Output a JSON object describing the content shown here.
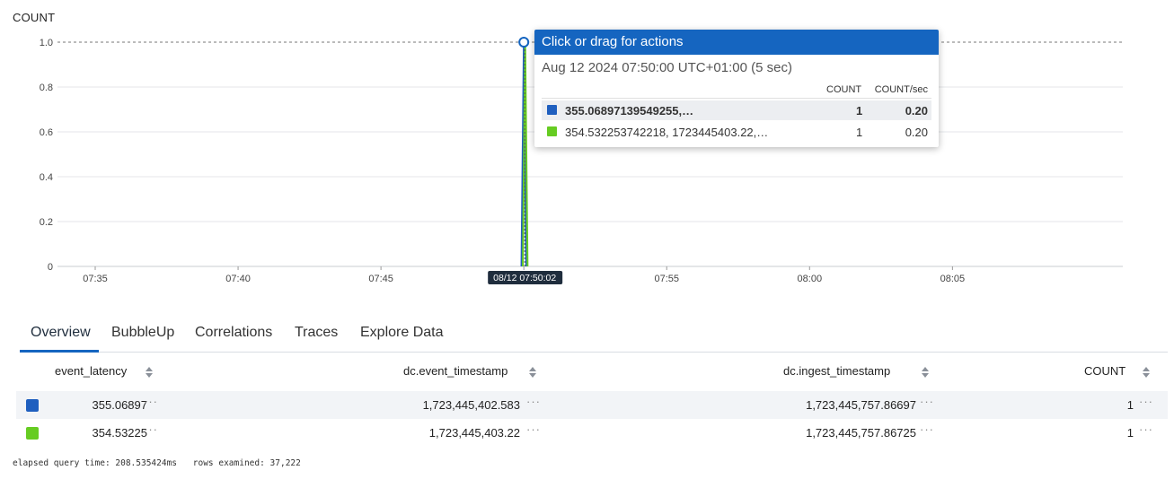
{
  "chart": {
    "title": "COUNT",
    "crosshair_label": "08/12 07:50:02"
  },
  "chart_data": {
    "type": "line",
    "ylabel": "COUNT",
    "ylim": [
      0,
      1
    ],
    "y_ticks": [
      "0",
      "0.2",
      "0.4",
      "0.6",
      "0.8",
      "1.0"
    ],
    "x_ticks": [
      "07:35",
      "07:40",
      "07:45",
      "07:50",
      "07:55",
      "08:00",
      "08:05"
    ],
    "grid": true,
    "series": [
      {
        "values": [
          {
            "x": "07:49:55",
            "y": 0
          },
          {
            "x": "07:50:00",
            "y": 1
          },
          {
            "x": "07:50:05",
            "y": 0
          }
        ],
        "color": "#1f5fbf"
      },
      {
        "values": [
          {
            "x": "07:49:55",
            "y": 0
          },
          {
            "x": "07:50:00",
            "y": 1
          },
          {
            "x": "07:50:05",
            "y": 0
          }
        ],
        "color": "#66cc22"
      }
    ]
  },
  "tooltip": {
    "header": "Click or drag for actions",
    "subtitle": "Aug 12 2024 07:50:00 UTC+01:00 (5 sec)",
    "col_count": "COUNT",
    "col_rate": "COUNT/sec",
    "rows": [
      {
        "label": "355.06897139549255,…",
        "count": "1",
        "rate": "0.20",
        "color": "#1f5fbf"
      },
      {
        "label": "354.532253742218, 1723445403.22,…",
        "count": "1",
        "rate": "0.20",
        "color": "#66cc22"
      }
    ]
  },
  "tabs": [
    "Overview",
    "BubbleUp",
    "Correlations",
    "Traces",
    "Explore Data"
  ],
  "table": {
    "headers": [
      "event_latency",
      "dc.event_timestamp",
      "dc.ingest_timestamp",
      "COUNT"
    ],
    "rows": [
      {
        "color": "#1f5fbf",
        "cells": [
          "355.06897",
          "1,723,445,402.583",
          "1,723,445,757.86697",
          "1"
        ]
      },
      {
        "color": "#66cc22",
        "cells": [
          "354.53225",
          "1,723,445,403.22",
          "1,723,445,757.86725",
          "1"
        ]
      }
    ],
    "more": "···"
  },
  "footer": {
    "elapsed": "elapsed query time: 208.535424ms",
    "rows": "rows examined: 37,222"
  }
}
